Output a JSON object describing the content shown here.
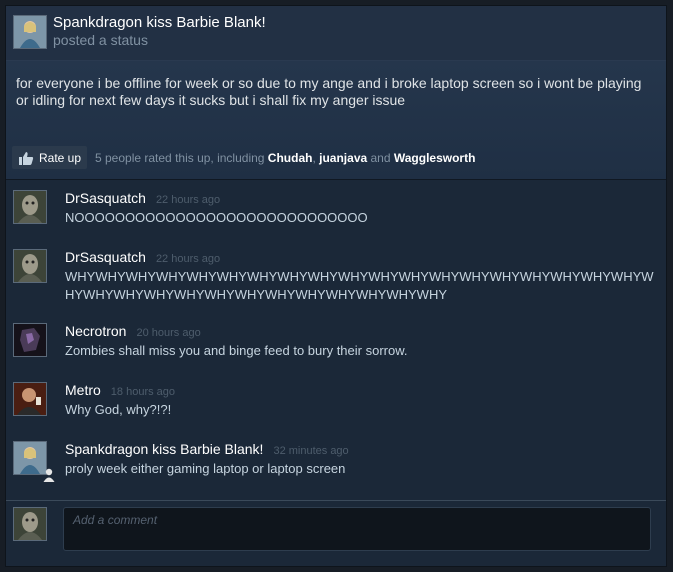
{
  "post": {
    "author": "Spankdragon kiss Barbie Blank!",
    "subtitle": "posted a status",
    "text": "for everyone i be offline for week or so due to my ange and i broke laptop screen so i wont be playing or idling for next few days it sucks but i shall fix my anger issue",
    "rate_label": "Rate up",
    "rated_prefix": "5 people rated this up, including ",
    "rated_users": [
      "Chudah",
      "juanjava",
      "Wagglesworth"
    ],
    "rated_sep1": ", ",
    "rated_sep2": " and "
  },
  "comments": [
    {
      "name": "DrSasquatch",
      "time": "22 hours ago",
      "text": "NOOOOOOOOOOOOOOOOOOOOOOOOOOOOO"
    },
    {
      "name": "DrSasquatch",
      "time": "22 hours ago",
      "text": "WHYWHYWHYWHYWHYWHYWHYWHYWHYWHYWHYWHYWHYWHYWHYWHYWHYWHYWHYWHYWHYWHYWHYWHYWHYWHYWHYWHYWHYWHYWHYWHY"
    },
    {
      "name": "Necrotron",
      "time": "20 hours ago",
      "text": "Zombies shall miss you and binge feed to bury their sorrow."
    },
    {
      "name": "Metro",
      "time": "18 hours ago",
      "text": "Why God, why?!?!"
    },
    {
      "name": "Spankdragon kiss Barbie Blank!",
      "time": "32 minutes ago",
      "text": "proly week either gaming laptop or laptop screen"
    }
  ],
  "comment_box": {
    "placeholder": "Add a comment"
  },
  "colors": {
    "background": "#1b2838",
    "link": "#ffffff",
    "muted": "#8091a2"
  }
}
